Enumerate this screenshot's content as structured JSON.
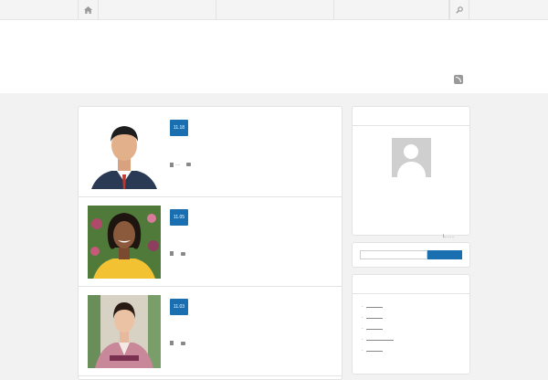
{
  "nav": {
    "home_icon": "home-icon",
    "search_icon": "search-icon"
  },
  "header": {
    "rss_icon": "rss-icon"
  },
  "posts": [
    {
      "date": "11.18",
      "meta_text": "...."
    },
    {
      "date": "11.05",
      "meta_text": ""
    },
    {
      "date": "11.03",
      "meta_text": ""
    }
  ],
  "sidebar": {
    "profile_more": "L……",
    "colors": {
      "accent": "#1a6fb0",
      "border": "#e3e3e3"
    }
  }
}
